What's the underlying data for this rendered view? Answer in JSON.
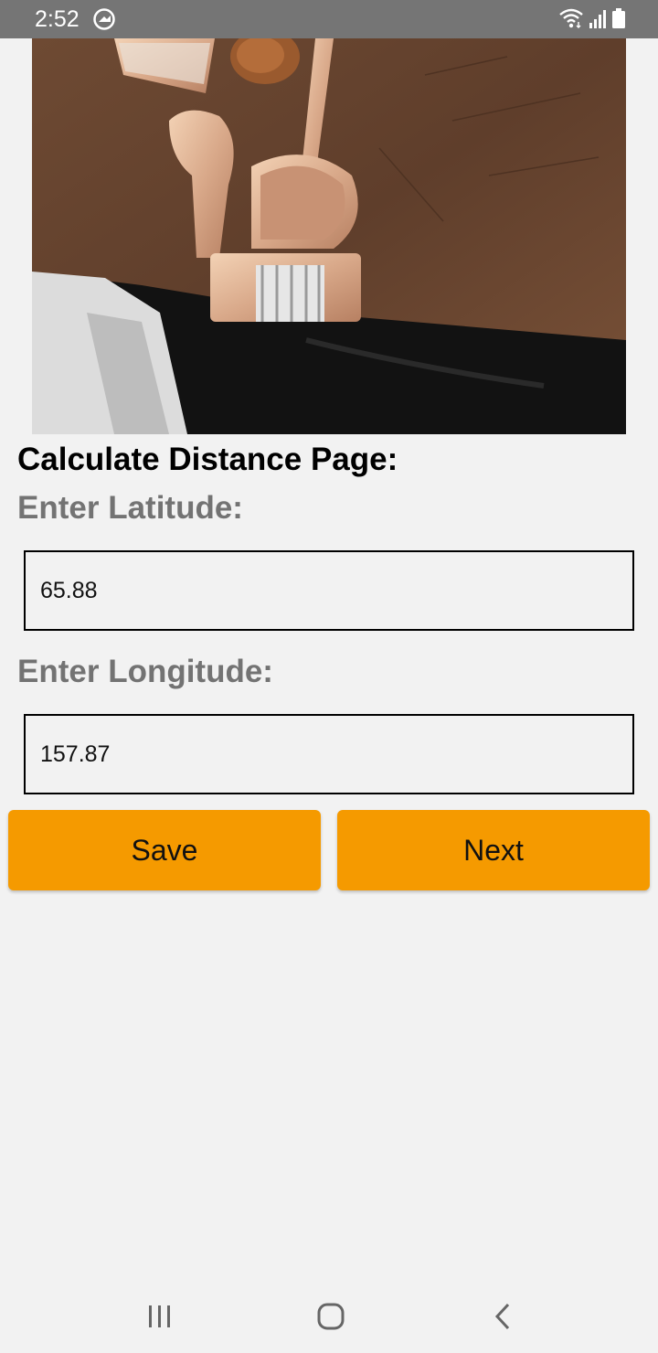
{
  "status_bar": {
    "time": "2:52",
    "icons": [
      "app-notification-icon",
      "wifi-icon",
      "signal-icon",
      "battery-icon"
    ]
  },
  "hero_image": {
    "subject": "bracelet-photo"
  },
  "form": {
    "heading": "Calculate Distance Page:",
    "latitude_label": "Enter Latitude:",
    "latitude_value": "65.88",
    "longitude_label": "Enter Longitude:",
    "longitude_value": "157.87"
  },
  "buttons": {
    "save_label": "Save",
    "next_label": "Next"
  },
  "nav_bar": {
    "items": [
      "recents-icon",
      "home-icon",
      "back-icon"
    ]
  },
  "colors": {
    "accent": "#F59A00",
    "status_bar": "#757575",
    "background": "#F2F2F2",
    "label_gray": "#737373"
  }
}
